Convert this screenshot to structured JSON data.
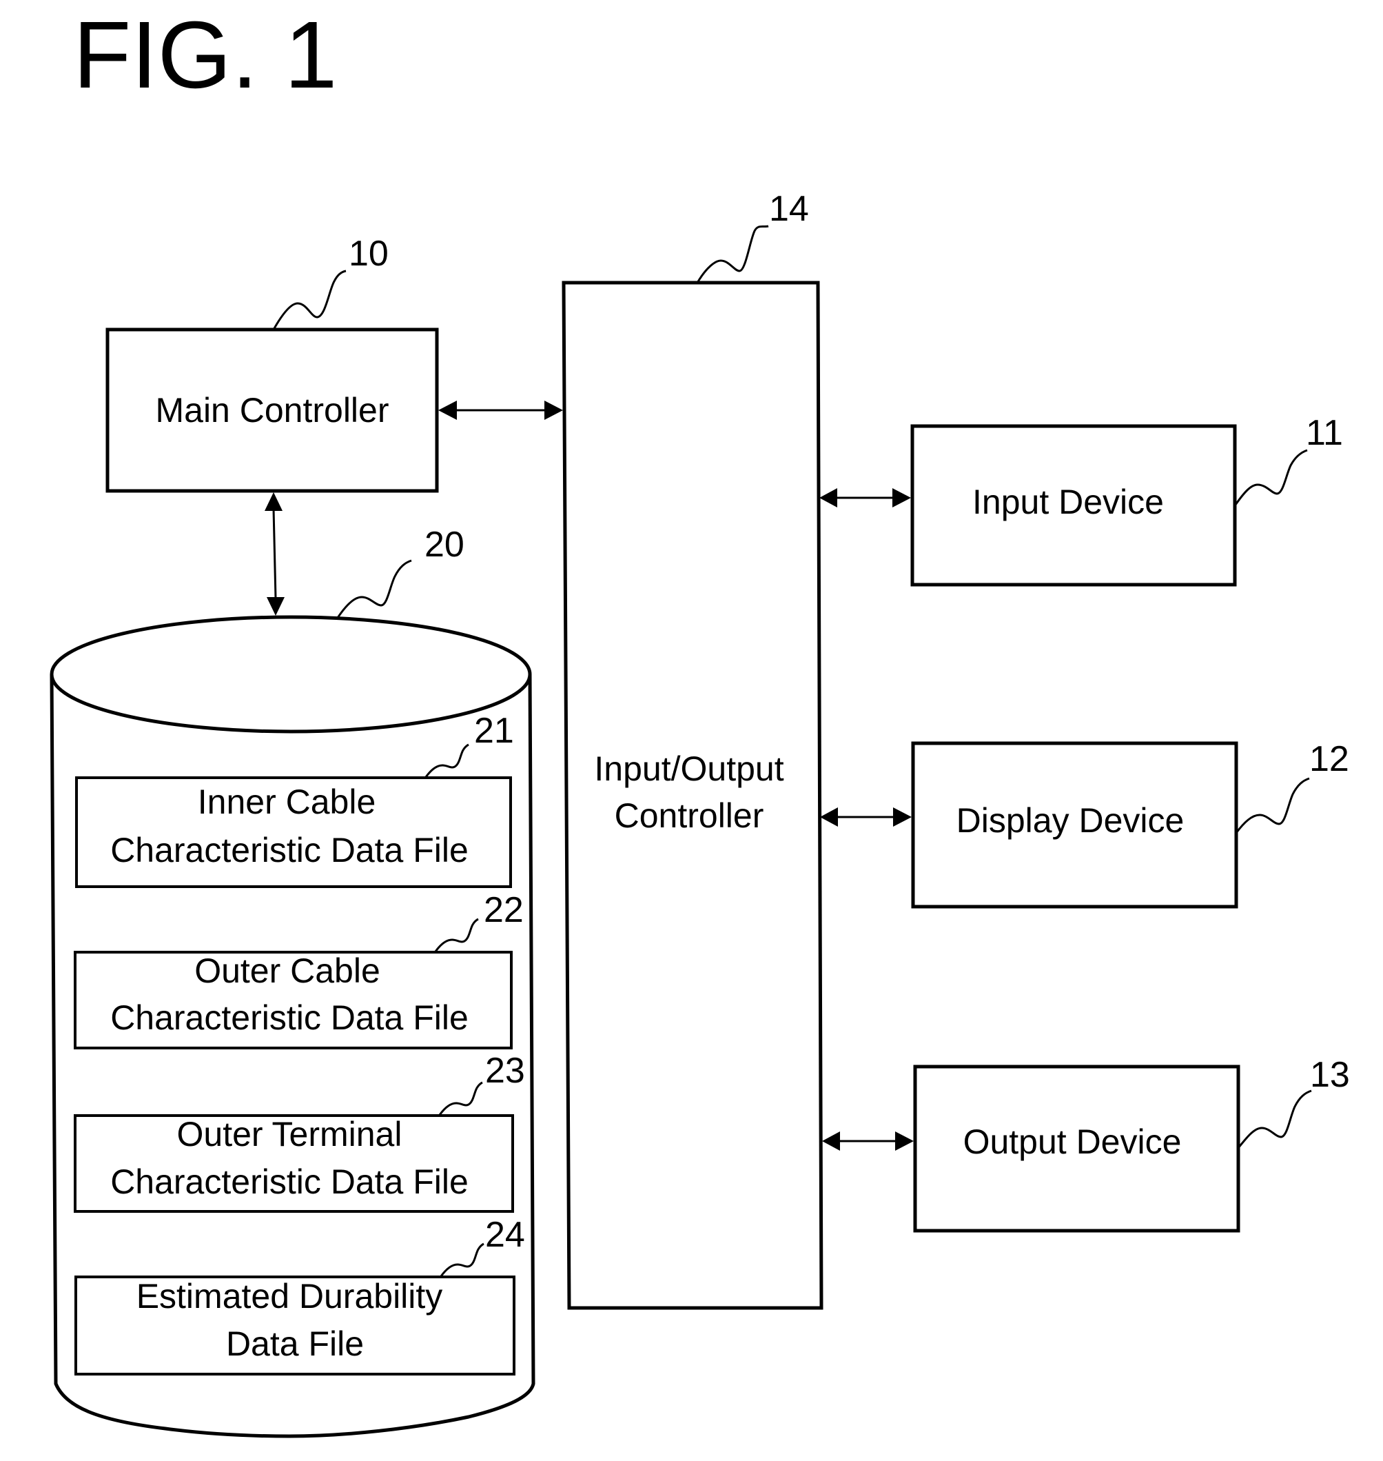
{
  "figure": {
    "title": "FIG. 1"
  },
  "colors": {
    "ink": "#000000",
    "paper": "#ffffff"
  },
  "blocks": {
    "main_controller": {
      "ref": "10",
      "label": "Main Controller"
    },
    "io_controller": {
      "ref": "14",
      "label_lines": [
        "Input/Output",
        "Controller"
      ]
    },
    "input_device": {
      "ref": "11",
      "label": "Input Device"
    },
    "display_device": {
      "ref": "12",
      "label": "Display Device"
    },
    "output_device": {
      "ref": "13",
      "label": "Output Device"
    },
    "storage": {
      "ref": "20",
      "files": [
        {
          "ref": "21",
          "label_lines": [
            "Inner Cable",
            "Characteristic Data File"
          ]
        },
        {
          "ref": "22",
          "label_lines": [
            "Outer Cable",
            "Characteristic Data File"
          ]
        },
        {
          "ref": "23",
          "label_lines": [
            "Outer Terminal",
            "Characteristic Data File"
          ]
        },
        {
          "ref": "24",
          "label_lines": [
            "Estimated Durability",
            "Data File"
          ]
        }
      ]
    }
  },
  "connections": [
    {
      "from": "main_controller",
      "to": "io_controller",
      "direction": "bidirectional"
    },
    {
      "from": "main_controller",
      "to": "storage",
      "direction": "bidirectional"
    },
    {
      "from": "io_controller",
      "to": "input_device",
      "direction": "bidirectional"
    },
    {
      "from": "io_controller",
      "to": "display_device",
      "direction": "bidirectional"
    },
    {
      "from": "io_controller",
      "to": "output_device",
      "direction": "bidirectional"
    }
  ]
}
